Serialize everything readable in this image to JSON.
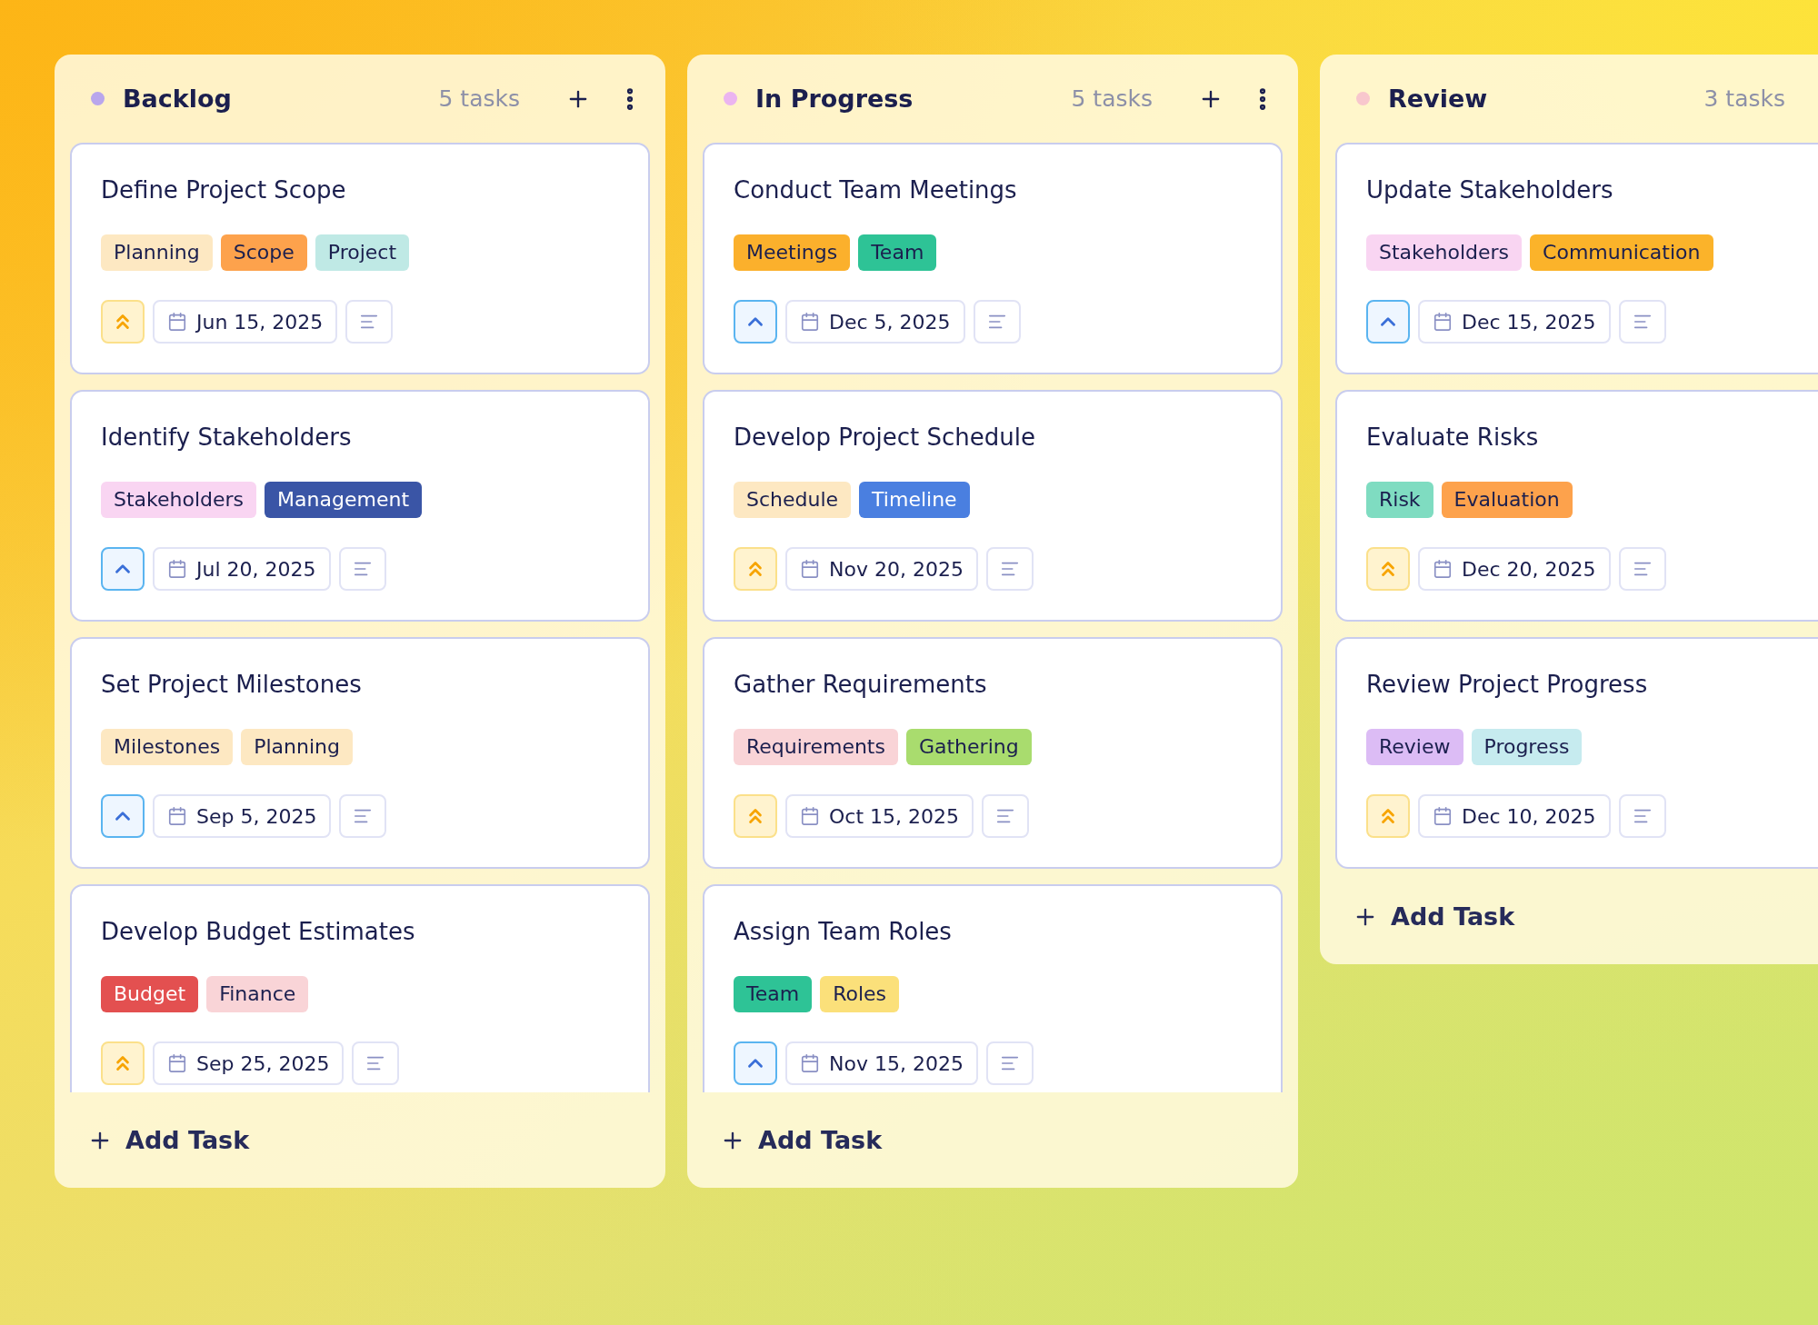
{
  "columns": [
    {
      "title": "Backlog",
      "color": "#b9a6ec",
      "count": "5 tasks",
      "has_actions": true,
      "add_label": "Add Task",
      "cards": [
        {
          "title": "Define Project Scope",
          "tags": [
            {
              "label": "Planning",
              "color": "#fde8c2"
            },
            {
              "label": "Scope",
              "color": "#fda24c"
            },
            {
              "label": "Project",
              "color": "#bfe9e5"
            }
          ],
          "high_priority": true,
          "date": "Jun 15, 2025"
        },
        {
          "title": "Identify Stakeholders",
          "tags": [
            {
              "label": "Stakeholders",
              "color": "#f9d5f2"
            },
            {
              "label": "Management",
              "color": "#3a55a6"
            }
          ],
          "high_priority": false,
          "date": "Jul 20, 2025"
        },
        {
          "title": "Set Project Milestones",
          "tags": [
            {
              "label": "Milestones",
              "color": "#fde8c2"
            },
            {
              "label": "Planning",
              "color": "#fde8c2"
            }
          ],
          "high_priority": false,
          "date": "Sep 5, 2025"
        },
        {
          "title": "Develop Budget Estimates",
          "tags": [
            {
              "label": "Budget",
              "color": "#e35050"
            },
            {
              "label": "Finance",
              "color": "#f9d4d7"
            }
          ],
          "high_priority": true,
          "date": "Sep 25, 2025"
        }
      ]
    },
    {
      "title": "In Progress",
      "color": "#ebb4f0",
      "count": "5 tasks",
      "has_actions": true,
      "add_label": "Add Task",
      "cards": [
        {
          "title": "Conduct Team Meetings",
          "tags": [
            {
              "label": "Meetings",
              "color": "#fbb02c"
            },
            {
              "label": "Team",
              "color": "#2ec396"
            }
          ],
          "high_priority": false,
          "date": "Dec 5, 2025"
        },
        {
          "title": "Develop Project Schedule",
          "tags": [
            {
              "label": "Schedule",
              "color": "#fde8c2"
            },
            {
              "label": "Timeline",
              "color": "#4a7fe0"
            }
          ],
          "high_priority": true,
          "date": "Nov 20, 2025"
        },
        {
          "title": "Gather Requirements",
          "tags": [
            {
              "label": "Requirements",
              "color": "#f9d4d7"
            },
            {
              "label": "Gathering",
              "color": "#a9dc6e"
            }
          ],
          "high_priority": true,
          "date": "Oct 15, 2025"
        },
        {
          "title": "Assign Team Roles",
          "tags": [
            {
              "label": "Team",
              "color": "#2ec396"
            },
            {
              "label": "Roles",
              "color": "#fbe07a"
            }
          ],
          "high_priority": false,
          "date": "Nov 15, 2025"
        }
      ]
    },
    {
      "title": "Review",
      "color": "#f8c7cd",
      "count": "3 tasks",
      "has_actions": false,
      "add_label": "Add Task",
      "cards": [
        {
          "title": "Update Stakeholders",
          "tags": [
            {
              "label": "Stakeholders",
              "color": "#f9d5f2"
            },
            {
              "label": "Communication",
              "color": "#fbb32a"
            }
          ],
          "high_priority": false,
          "date": "Dec 15, 2025"
        },
        {
          "title": "Evaluate Risks",
          "tags": [
            {
              "label": "Risk",
              "color": "#7fdcc1"
            },
            {
              "label": "Evaluation",
              "color": "#fda24c"
            }
          ],
          "high_priority": true,
          "date": "Dec 20, 2025"
        },
        {
          "title": "Review Project Progress",
          "tags": [
            {
              "label": "Review",
              "color": "#dcbcf5"
            },
            {
              "label": "Progress",
              "color": "#c6ebef"
            }
          ],
          "high_priority": true,
          "date": "Dec 10, 2025"
        }
      ]
    }
  ]
}
